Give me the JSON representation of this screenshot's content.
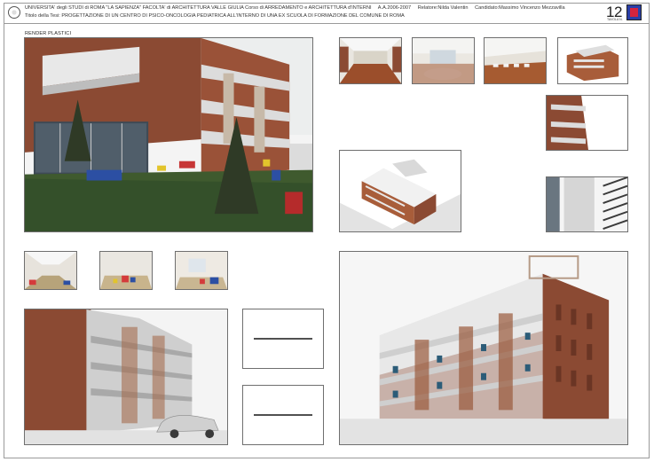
{
  "header": {
    "university_line": "UNIVERSITA' degli STUDI di ROMA \"LA SAPIENZA\" FACOLTA' di ARCHITETTURA VALLE GIULIA Corso di ARREDAMENTO e ARCHITETTURA d'INTERNI",
    "academic_year": "A.A.2006-2007",
    "relatore": "Relatore:Nilda Valentin",
    "candidato": "Candidato:Massimo Vincenzo Mezzavilla",
    "thesis_title": "Titolo della Tesi: PROGETTAZIONE DI UN CENTRO DI PSICO-ONCOLOGIA PEDIATRICA ALL'INTERNO DI UNA EX SCUOLA DI FORMAZIONE DEL COMUNE DI ROMA",
    "page_number": "12",
    "page_number_sub": "TAVOLA N.",
    "logo_icon": "university-seal-icon",
    "brand_icon": "studio-logo-icon"
  },
  "section": {
    "title": "RENDER PLASTICI"
  },
  "captions": [
    "·································",
    "·································"
  ],
  "colors": {
    "brick": "#8b4a33",
    "grass": "#3f5a2e",
    "frame": "#9a9a9a",
    "brand_blue": "#2a3fa8",
    "brand_red": "#d4243e"
  }
}
